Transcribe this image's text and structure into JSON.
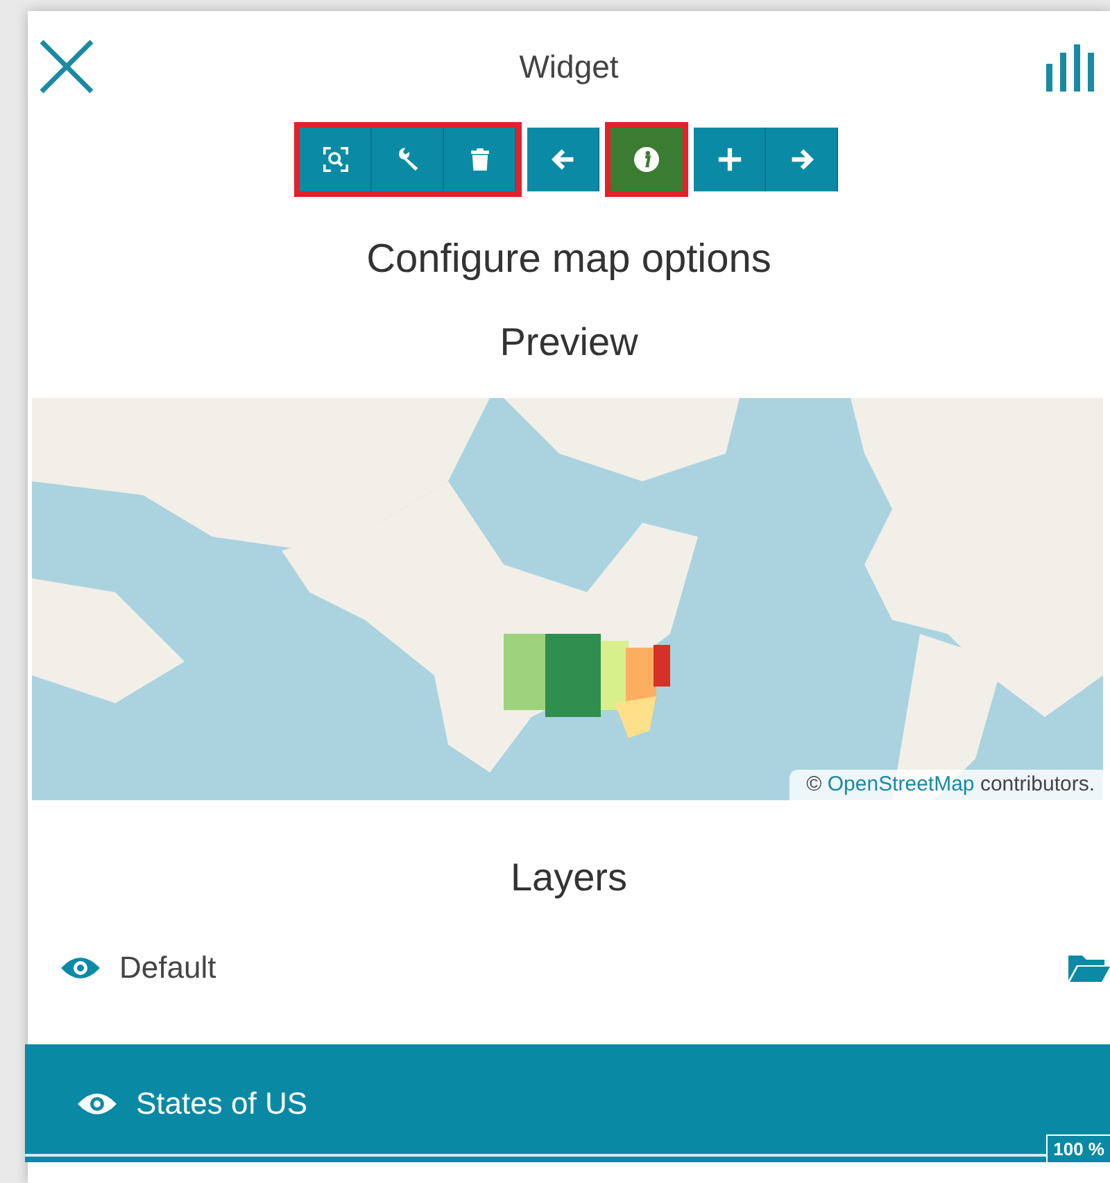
{
  "header": {
    "title": "Widget"
  },
  "toolbar": [
    {
      "highlighted": true,
      "buttons": [
        {
          "kind": "zoom",
          "selected": false
        },
        {
          "kind": "wrench",
          "selected": false
        },
        {
          "kind": "trash",
          "selected": false
        }
      ]
    },
    {
      "highlighted": false,
      "buttons": [
        {
          "kind": "back",
          "selected": false
        }
      ]
    },
    {
      "highlighted": true,
      "buttons": [
        {
          "kind": "info",
          "selected": true
        }
      ]
    },
    {
      "highlighted": false,
      "buttons": [
        {
          "kind": "add",
          "selected": false
        },
        {
          "kind": "forward",
          "selected": false
        }
      ]
    }
  ],
  "heading": "Configure map options",
  "preview": {
    "title": "Preview",
    "attribution": {
      "symbol": "©",
      "link": "OpenStreetMap",
      "rest": "contributors."
    }
  },
  "layers": {
    "title": "Layers",
    "items": [
      {
        "name": "Default",
        "visible": true,
        "selected": false,
        "folder": true
      },
      {
        "name": "States of US",
        "visible": true,
        "selected": true,
        "level": 1,
        "reading": "100 %"
      }
    ]
  }
}
